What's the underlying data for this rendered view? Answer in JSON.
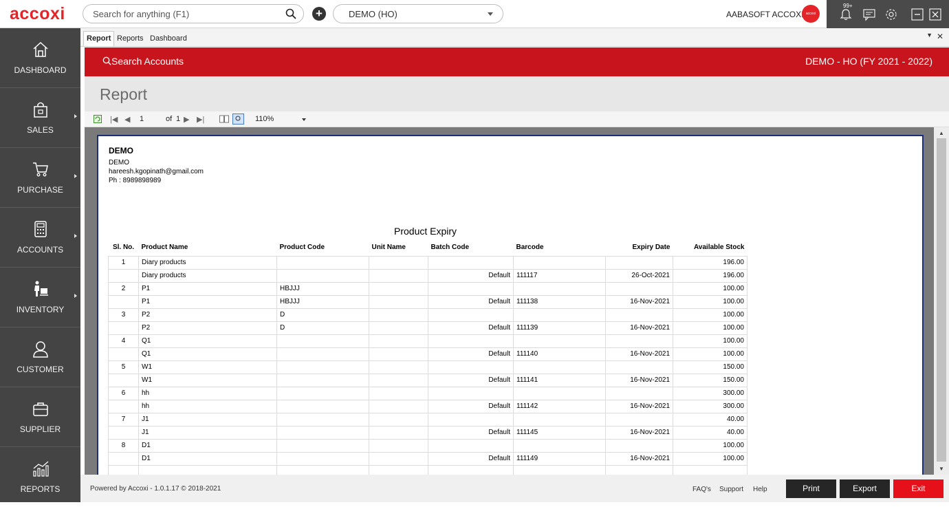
{
  "app": {
    "logo": "accoxi",
    "search_placeholder": "Search for anything (F1)",
    "branch": "DEMO (HO)",
    "user": "AABASOFT ACCOXI",
    "avatar_text": "accoxi",
    "notification_badge": "99+"
  },
  "sidebar": {
    "items": [
      {
        "label": "DASHBOARD",
        "icon": "home-icon"
      },
      {
        "label": "SALES",
        "icon": "shopping-bag-icon"
      },
      {
        "label": "PURCHASE",
        "icon": "cart-icon"
      },
      {
        "label": "ACCOUNTS",
        "icon": "calculator-icon"
      },
      {
        "label": "INVENTORY",
        "icon": "inventory-icon"
      },
      {
        "label": "CUSTOMER",
        "icon": "user-icon"
      },
      {
        "label": "SUPPLIER",
        "icon": "briefcase-icon"
      },
      {
        "label": "REPORTS",
        "icon": "chart-icon"
      }
    ]
  },
  "tabs": [
    "Report",
    "Reports",
    "Dashboard"
  ],
  "header": {
    "search_accounts": "Search Accounts",
    "company": "DEMO - HO (FY 2021 - 2022)"
  },
  "page_title": "Report",
  "viewer": {
    "page": "1",
    "of_label": "of",
    "total_pages": "1",
    "zoom": "110%"
  },
  "report": {
    "company_name": "DEMO",
    "company_line": "DEMO",
    "email": "hareesh.kgopinath@gmail.com",
    "phone": "Ph : 8989898989",
    "title": "Product Expiry",
    "columns": [
      "Sl. No.",
      "Product Name",
      "Product Code",
      "Unit Name",
      "Batch Code",
      "Barcode",
      "Expiry Date",
      "Available Stock"
    ],
    "rows": [
      {
        "sl": "1",
        "name": "Diary products",
        "code": "",
        "unit": "",
        "batch": "",
        "barcode": "",
        "expiry": "",
        "stock": "196.00"
      },
      {
        "sl": "",
        "name": "Diary products",
        "code": "",
        "unit": "",
        "batch": "Default",
        "barcode": "111117",
        "expiry": "26-Oct-2021",
        "stock": "196.00"
      },
      {
        "sl": "2",
        "name": "P1",
        "code": "HBJJJ",
        "unit": "",
        "batch": "",
        "barcode": "",
        "expiry": "",
        "stock": "100.00"
      },
      {
        "sl": "",
        "name": "P1",
        "code": "HBJJJ",
        "unit": "",
        "batch": "Default",
        "barcode": "111138",
        "expiry": "16-Nov-2021",
        "stock": "100.00"
      },
      {
        "sl": "3",
        "name": "P2",
        "code": "D",
        "unit": "",
        "batch": "",
        "barcode": "",
        "expiry": "",
        "stock": "100.00"
      },
      {
        "sl": "",
        "name": "P2",
        "code": "D",
        "unit": "",
        "batch": "Default",
        "barcode": "111139",
        "expiry": "16-Nov-2021",
        "stock": "100.00"
      },
      {
        "sl": "4",
        "name": "Q1",
        "code": "",
        "unit": "",
        "batch": "",
        "barcode": "",
        "expiry": "",
        "stock": "100.00"
      },
      {
        "sl": "",
        "name": "Q1",
        "code": "",
        "unit": "",
        "batch": "Default",
        "barcode": "111140",
        "expiry": "16-Nov-2021",
        "stock": "100.00"
      },
      {
        "sl": "5",
        "name": "W1",
        "code": "",
        "unit": "",
        "batch": "",
        "barcode": "",
        "expiry": "",
        "stock": "150.00"
      },
      {
        "sl": "",
        "name": "W1",
        "code": "",
        "unit": "",
        "batch": "Default",
        "barcode": "111141",
        "expiry": "16-Nov-2021",
        "stock": "150.00"
      },
      {
        "sl": "6",
        "name": "hh",
        "code": "",
        "unit": "",
        "batch": "",
        "barcode": "",
        "expiry": "",
        "stock": "300.00"
      },
      {
        "sl": "",
        "name": "hh",
        "code": "",
        "unit": "",
        "batch": "Default",
        "barcode": "111142",
        "expiry": "16-Nov-2021",
        "stock": "300.00"
      },
      {
        "sl": "7",
        "name": "J1",
        "code": "",
        "unit": "",
        "batch": "",
        "barcode": "",
        "expiry": "",
        "stock": "40.00"
      },
      {
        "sl": "",
        "name": "J1",
        "code": "",
        "unit": "",
        "batch": "Default",
        "barcode": "111145",
        "expiry": "16-Nov-2021",
        "stock": "40.00"
      },
      {
        "sl": "8",
        "name": "D1",
        "code": "",
        "unit": "",
        "batch": "",
        "barcode": "",
        "expiry": "",
        "stock": "100.00"
      },
      {
        "sl": "",
        "name": "D1",
        "code": "",
        "unit": "",
        "batch": "Default",
        "barcode": "111149",
        "expiry": "16-Nov-2021",
        "stock": "100.00"
      },
      {
        "sl": "",
        "name": "",
        "code": "",
        "unit": "",
        "batch": "",
        "barcode": "",
        "expiry": "",
        "stock": ""
      }
    ]
  },
  "footer": {
    "powered": "Powered by Accoxi - 1.0.1.17 © 2018-2021",
    "faq": "FAQ's",
    "support": "Support",
    "help": "Help",
    "print": "Print",
    "export": "Export",
    "exit": "Exit"
  },
  "colors": {
    "brand_red": "#c8141c",
    "sidebar": "#444444",
    "exit_red": "#e5101a"
  }
}
